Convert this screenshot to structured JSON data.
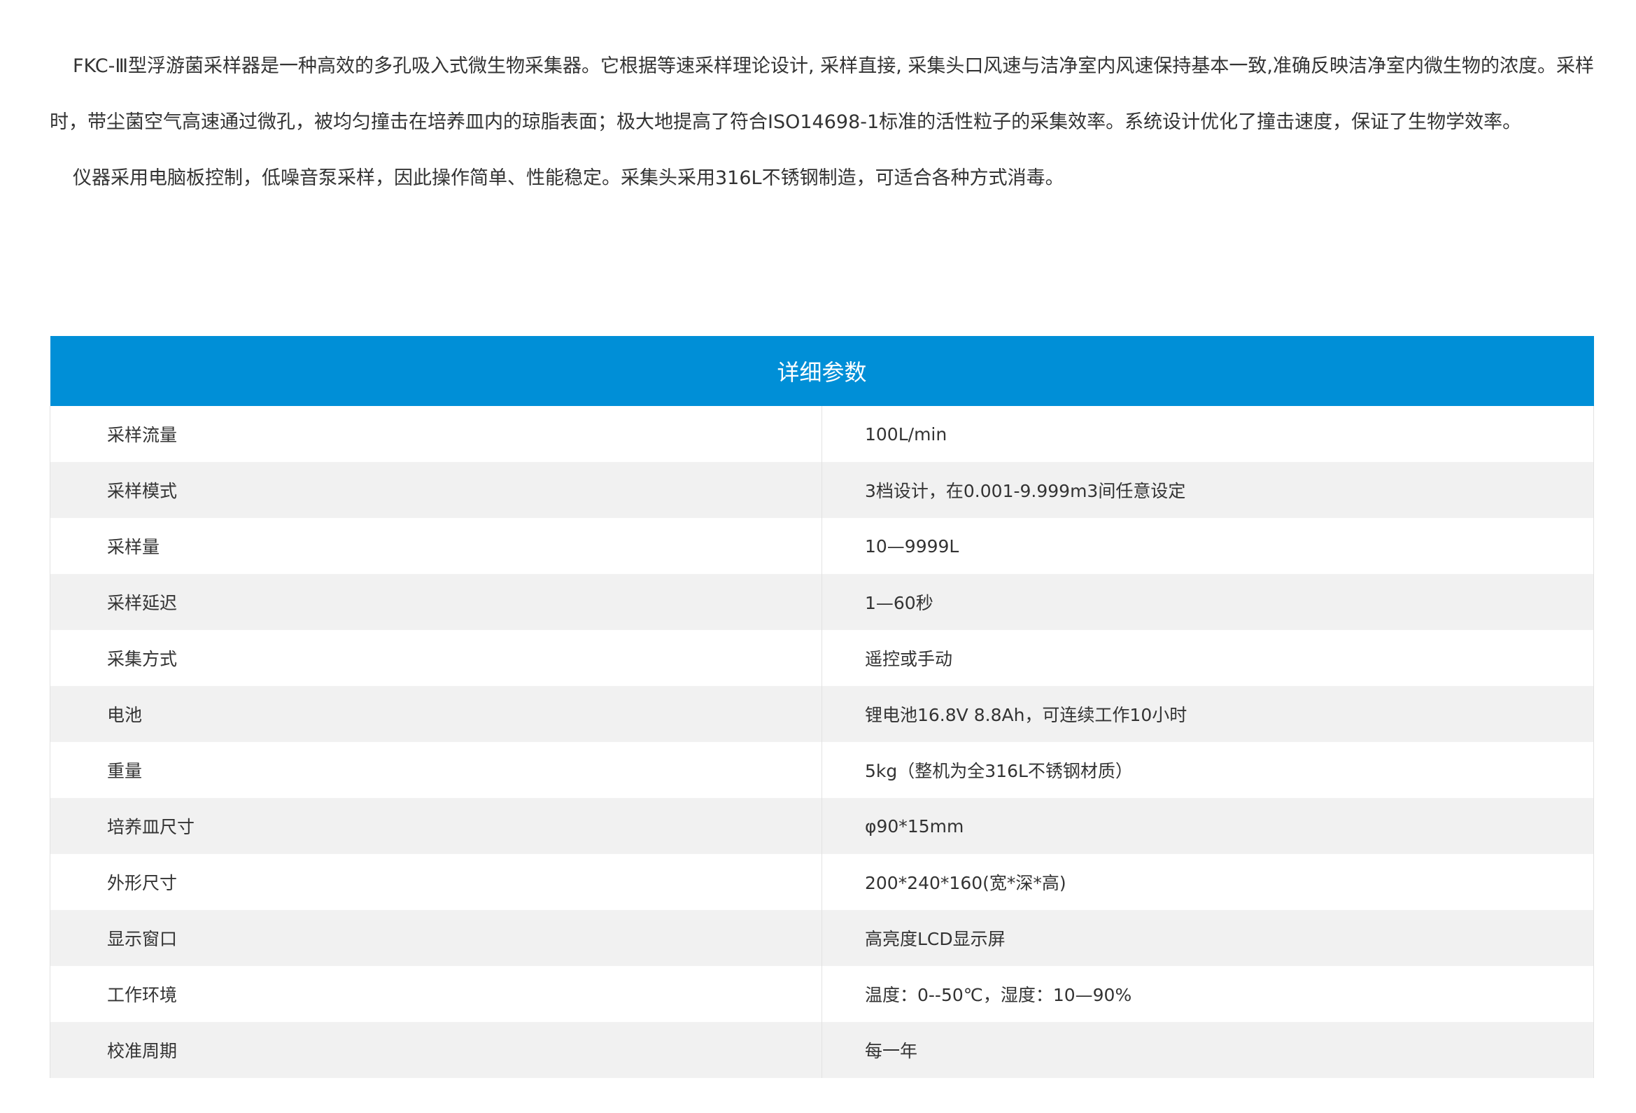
{
  "intro": {
    "paragraph_1": "FKC-Ⅲ型浮游菌采样器是一种高效的多孔吸入式微生物采集器。它根据等速采样理论设计, 采样直接, 采集头口风速与洁净室内风速保持基本一致,准确反映洁净室内微生物的浓度。采样时，带尘菌空气高速通过微孔，被均匀撞击在培养皿内的琼脂表面；极大地提高了符合ISO14698-1标准的活性粒子的采集效率。系统设计优化了撞击速度，保证了生物学效率。",
    "paragraph_2": "仪器采用电脑板控制，低噪音泵采样，因此操作简单、性能稳定。采集头采用316L不锈钢制造，可适合各种方式消毒。"
  },
  "spec_table": {
    "title": "详细参数",
    "header_color": "#008fd7",
    "rows": [
      {
        "label": "采样流量",
        "value": "100L/min"
      },
      {
        "label": "采样模式",
        "value": "3档设计，在0.001-9.999m3间任意设定"
      },
      {
        "label": "采样量",
        "value": "10—9999L"
      },
      {
        "label": "采样延迟",
        "value": "1—60秒"
      },
      {
        "label": "采集方式",
        "value": "遥控或手动"
      },
      {
        "label": "电池",
        "value": "锂电池16.8V 8.8Ah，可连续工作10小时"
      },
      {
        "label": "重量",
        "value": "5kg（整机为全316L不锈钢材质）"
      },
      {
        "label": "培养皿尺寸",
        "value": "φ90*15mm"
      },
      {
        "label": "外形尺寸",
        "value": "200*240*160(宽*深*高)"
      },
      {
        "label": "显示窗口",
        "value": "高亮度LCD显示屏"
      },
      {
        "label": "工作环境",
        "value": "温度：0--50℃，湿度：10—90%"
      },
      {
        "label": "校准周期",
        "value": "每一年"
      }
    ]
  }
}
